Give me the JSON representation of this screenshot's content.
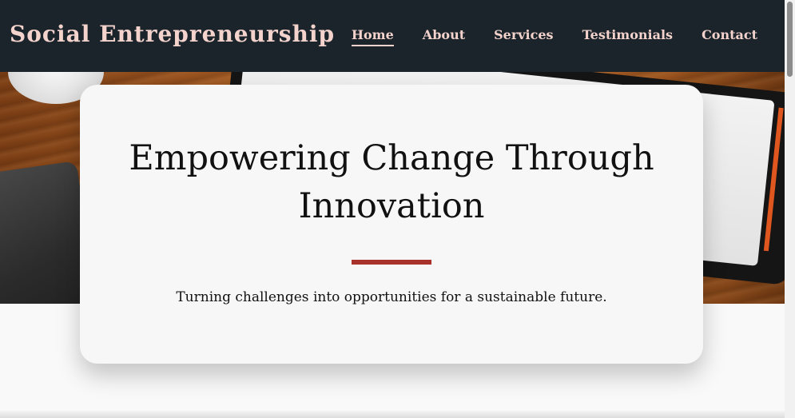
{
  "header": {
    "brand": "Social Entrepreneurship",
    "nav": [
      {
        "label": "Home",
        "active": true
      },
      {
        "label": "About",
        "active": false
      },
      {
        "label": "Services",
        "active": false
      },
      {
        "label": "Testimonials",
        "active": false
      },
      {
        "label": "Contact",
        "active": false
      }
    ]
  },
  "hero": {
    "title": "Empowering Change Through Innovation",
    "subtitle": "Turning challenges into opportunities for a sustainable future."
  },
  "colors": {
    "header_bg": "#1b232b",
    "header_text": "#f3d3cc",
    "accent": "#a8322a",
    "card_bg": "#f7f7f7"
  }
}
